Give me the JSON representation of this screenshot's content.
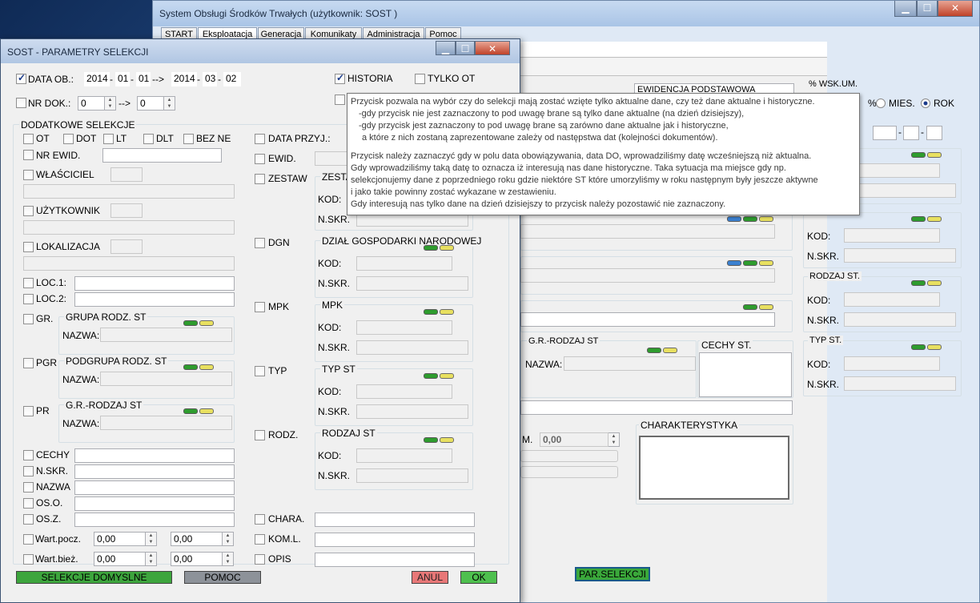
{
  "main": {
    "title": "System Obsługi Środków Trwałych  (użytkownik:   SOST   )",
    "win_min": "▁",
    "win_max": "☐",
    "win_close": "✕",
    "tabs": [
      "START",
      "Eksploatacja",
      "Generacja",
      "Komunikaty",
      "Administracja",
      "Pomoc"
    ],
    "ewidencja": "EWIDENCJA PODSTAWOWA",
    "wsk_um": "% WSK.UM.",
    "pct": "%",
    "mies": "MIES.",
    "rok": "ROK",
    "kod": "KOD:",
    "nskr": "N.SKR.",
    "rodzaj_st": "RODZAJ ST.",
    "typ_st": "TYP ST.",
    "gr_rodzaj_st": "G.R.-RODZAJ ST",
    "nazwa": "NAZWA:",
    "cechy_st": "CECHY ST.",
    "charakterystyka": "CHARAKTERYSTYKA",
    "um_val": "0,00",
    "um_lbl": "M.",
    "par_selekcji": "PAR.SELEKCJI"
  },
  "dialog": {
    "title": "SOST - PARAMETRY SELEKCJI",
    "min": "▁",
    "max": "☐",
    "close": "✕",
    "data_ob": "DATA OB.:",
    "d1": [
      "2014",
      "01",
      "01"
    ],
    "arrow": "-->",
    "d2": [
      "2014",
      "03",
      "02"
    ],
    "dash": "-",
    "historia": "HISTORIA",
    "tylko_ot": "TYLKO OT",
    "nr_dok": "NR DOK.:",
    "nr_from": "0",
    "nr_arrow": "-->",
    "nr_to": "0",
    "dodatkowe": "DODATKOWE SELEKCJE",
    "ot": "OT",
    "dot": "DOT",
    "lt": "LT",
    "dlt": "DLT",
    "bez_ne": "BEZ NE",
    "nr_ewid": "NR EWID.",
    "wlasciciel": "WŁAŚCICIEL",
    "uzytkownik": "UŻYTKOWNIK",
    "lokalizacja": "LOKALIZACJA",
    "loc1": "LOC.1:",
    "loc2": "LOC.2:",
    "gr": "GR.",
    "grupa_rodz": "GRUPA RODZ. ST",
    "pgr": "PGR",
    "podgrupa": "PODGRUPA RODZ. ST",
    "pr": "PR",
    "gr_rodzaj": "G.R.-RODZAJ ST",
    "nazwa": "NAZWA:",
    "cechy": "CECHY",
    "nskr": "N.SKR.",
    "nazwa2": "NAZWA",
    "oso": "OS.O.",
    "osz": "OS.Z.",
    "wart_pocz": "Wart.pocz.",
    "wart_biez": "Wart.bież.",
    "v": "0,00",
    "data_przyj": "DATA PRZYJ.:",
    "ewid": "EWID.",
    "zestaw": "ZESTAW",
    "zesta": "ZESTA",
    "kod": "KOD:",
    "dgn": "DGN",
    "dzial": "DZIAŁ GOSPODARKI NARODOWEJ",
    "mpk": "MPK",
    "mpk2": "MPK",
    "typ": "TYP",
    "typ_st": "TYP ST",
    "rodz": "RODZ.",
    "rodzaj_st": "RODZAJ ST",
    "chara": "CHARA.",
    "koml": "KOM.L.",
    "opis": "OPIS",
    "selekcje": "SELEKCJE DOMYSLNE",
    "pomoc": "POMOC",
    "anul": "ANUL",
    "ok": "OK"
  },
  "tooltip": [
    "Przycisk pozwala na wybór czy do selekcji mają zostać wzięte tylko aktualne dane, czy też dane aktualne i historyczne.",
    "  -gdy przycisk nie jest zaznaczony to pod uwagę brane są tylko dane aktualne (na dzień dzisiejszy),",
    "  -gdy przycisk jest zaznaczony to pod uwagę brane są zarówno dane aktualne jak i historyczne,",
    "   a które z nich zostaną zaprezentowane zależy od następstwa dat (kolejności dokumentów).",
    "",
    "Przycisk należy zaznaczyć gdy w polu data obowiązywania, data DO, wprowadziliśmy datę wcześniejszą niż aktualna.",
    "Gdy wprowadziliśmy taką datę to oznacza iż interesują nas dane historyczne. Taka sytuacja ma miejsce gdy np.",
    "selekcjonujemy dane z poprzedniego roku gdzie niektóre ST które umorzyliśmy w roku następnym były jeszcze aktywne",
    "i jako takie powinny zostać wykazane w zestawieniu.",
    "Gdy interesują nas tylko dane na dzień dzisiejszy to przycisk należy pozostawić nie zaznaczony."
  ]
}
